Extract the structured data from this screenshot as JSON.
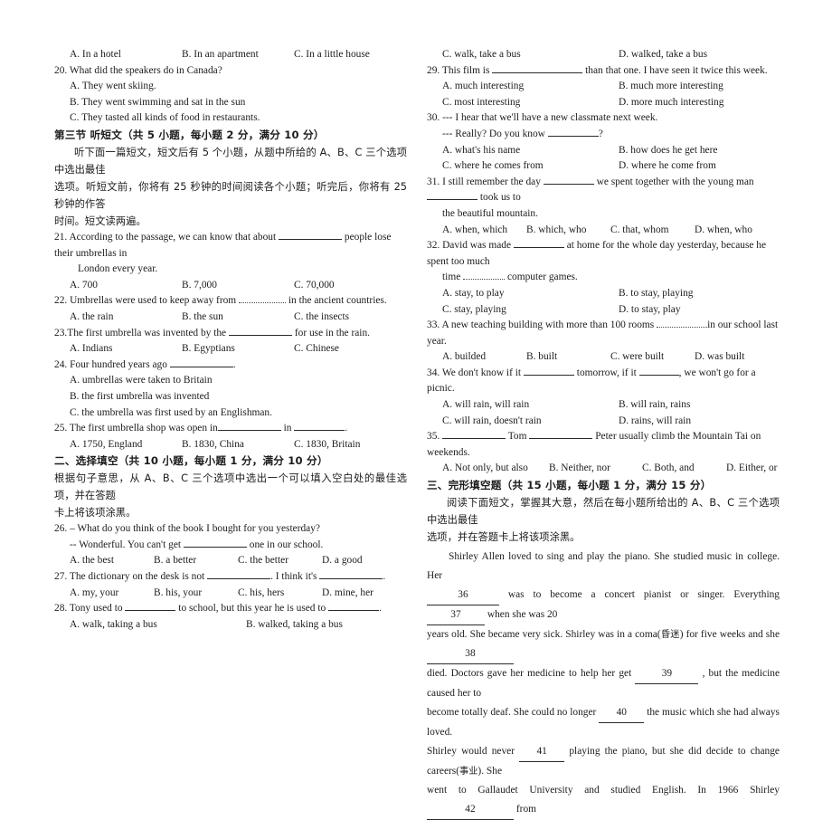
{
  "left_column": {
    "q19_options": {
      "a": "A. In a hotel",
      "b": "B. In an apartment",
      "c": "C. In a little house"
    },
    "q20": {
      "stem": "20. What did the speakers do in Canada?",
      "a": "A. They went skiing.",
      "b": "B. They went swimming and sat in the sun",
      "c": "C. They tasted all kinds of food in restaurants."
    },
    "section3": {
      "title": "第三节  听短文",
      "score_note": "（共 5 小题，每小题 2 分，满分 10 分）",
      "instruction_line1": "听下面一篇短文，短文后有 5 个小题，从题中所给的 A、B、C 三个选项中选出最佳",
      "instruction_line2": "选项。听短文前，你将有 25 秒钟的时间阅读各个小题；听完后，你将有 25 秒钟的作答",
      "instruction_line3": "时间。短文读两遍。"
    },
    "q21": {
      "stem_part1": "21. According to the passage, we can know that about",
      "stem_part2": "people lose their umbrellas in",
      "stem_line2": "London every year.",
      "a": "A. 700",
      "b": "B. 7,000",
      "c": "C. 70,000"
    },
    "q22": {
      "stem_part1": "22. Umbrellas were used to keep away from",
      "stem_part2": "in the ancient countries.",
      "a": "A. the rain",
      "b": "B. the sun",
      "c": "C. the insects"
    },
    "q23": {
      "stem_part1": "23.The first umbrella was invented by the",
      "stem_part2": "for use in the rain.",
      "a": "A. Indians",
      "b": "B. Egyptians",
      "c": "C. Chinese"
    },
    "q24": {
      "stem_part1": "24. Four hundred years ago",
      "stem_part2": ".",
      "a": "A. umbrellas were taken to Britain",
      "b": "B. the first umbrella was invented",
      "c": "C. the umbrella was first used by an Englishman."
    },
    "q25": {
      "stem_part1": "25. The first umbrella shop was open in",
      "stem_part2": "in",
      "stem_part3": ".",
      "a": "A. 1750, England",
      "b": "B. 1830, China",
      "c": "C. 1830, Britain"
    },
    "section2": {
      "title": "二、选择填空",
      "score_note": "（共 10 小题，每小题 1 分，满分 10 分）",
      "instruction_line1": "根据句子意思，从 A、B、C 三个选项中选出一个可以填入空白处的最佳选项，并在答题",
      "instruction_line2": "卡上将该项涂黑。"
    },
    "q26": {
      "stem": "26. – What do you think of the book I bought for you yesterday?",
      "reply_part1": "-- Wonderful. You can't get",
      "reply_part2": "one in our school.",
      "a": "A. the best",
      "b": "B. a better",
      "c": "C. the better",
      "d": "D. a good"
    },
    "q27": {
      "stem_part1": "27. The dictionary on the desk is not",
      "stem_part2": ". I think it's",
      "stem_part3": ".",
      "a": "A. my, your",
      "b": "B. his, your",
      "c": "C. his, hers",
      "d": "D. mine, her"
    },
    "q28": {
      "stem_part1": "28. Tony used to",
      "stem_part2": "to school, but this year he is used to",
      "stem_part3": ".",
      "a": "A. walk, taking a bus",
      "b": "B. walked, taking a bus"
    }
  },
  "right_column": {
    "q28_options_cont": {
      "c": "C. walk, take a bus",
      "d": "D. walked, take a bus"
    },
    "q29": {
      "stem_part1": "29. This film is",
      "stem_part2": "than that one. I have seen it twice this week.",
      "a": "A. much interesting",
      "b": "B. much more interesting",
      "c": "C. most interesting",
      "d": "D. more much interesting"
    },
    "q30": {
      "stem": "30. --- I hear that we'll have a new classmate next week.",
      "reply_part1": "--- Really? Do you know",
      "reply_part2": "?",
      "a": "A. what's his name",
      "b": "B. how does he get here",
      "c": "C. where he comes from",
      "d": "D. where he come from"
    },
    "q31": {
      "stem_part1": "31. I still remember the day",
      "stem_part2": "we spent together with the young man",
      "stem_part3": "took us to",
      "stem_line2": "the beautiful mountain.",
      "a": "A. when, which",
      "b": "B. which, who",
      "c": "C. that, whom",
      "d": "D. when, who"
    },
    "q32": {
      "stem_part1": "32. David was made",
      "stem_part2": "at home for the whole day yesterday, because he spent too much",
      "stem_line2_part1": "time",
      "stem_line2_part2": "computer games.",
      "a": "A. stay, to play",
      "b": "B. to stay, playing",
      "c": "C. stay, playing",
      "d": "D. to stay, play"
    },
    "q33": {
      "stem_part1": "33. A new teaching building with more than 100 rooms",
      "stem_part2": "in our school last year.",
      "a": "A.  builded",
      "b": "B. built",
      "c": "C. were built",
      "d": "D. was built"
    },
    "q34": {
      "stem_part1": "34. We don't know if it",
      "stem_part2": "tomorrow, if it",
      "stem_part3": ", we won't go for a picnic.",
      "a": "A. will rain, will rain",
      "b": "B. will rain, rains",
      "c": "C. will rain, doesn't rain",
      "d": "D. rains, will rain"
    },
    "q35": {
      "stem_part1": "35.",
      "stem_part2": "Tom",
      "stem_part3": "Peter usually climb the Mountain Tai on weekends.",
      "a": "A. Not only, but also",
      "b": "B. Neither, nor",
      "c": "C. Both, and",
      "d": "D. Either, or"
    },
    "section3": {
      "title": "三、完形填空题",
      "score_note": "（共 15 小题，每小题 1 分，满分 15 分）",
      "instruction_line1": "阅读下面短文，掌握其大意，然后在每小题所给出的 A、B、C 三个选项中选出最佳",
      "instruction_line2": "选项，并在答题卡上将该项涂黑。"
    },
    "cloze_passage": {
      "p1": "Shirley  Allen  loved  to  sing  and  play  the  piano.  She  studied  music  in  college.  Her",
      "blank36": "36",
      "p2": "was to become a concert pianist or singer. Everything",
      "blank37": "37",
      "p3": "when she was 20",
      "p4": "years old. She became very sick. Shirley was in a coma(",
      "coma_gloss": "昏迷",
      "p5": ") for five weeks and she",
      "blank38": "38",
      "p6": "died. Doctors gave her medicine to help her get",
      "blank39": "39",
      "p7": ", but the medicine caused her to",
      "p8": "become  totally  deaf.  She  could  no  longer",
      "blank40": "40",
      "p9": "the  music  which  she  had  always  loved.",
      "p10": "Shirley  would  never",
      "blank41": "41",
      "p11": "playing the piano, but she did decide to change careers(",
      "careers_gloss": "事业",
      "p12": "). She",
      "p13": "went  to  Gallaudet  University  and  studied  English.  In  1966  Shirley",
      "blank42": "42",
      "p14": "from"
    }
  }
}
